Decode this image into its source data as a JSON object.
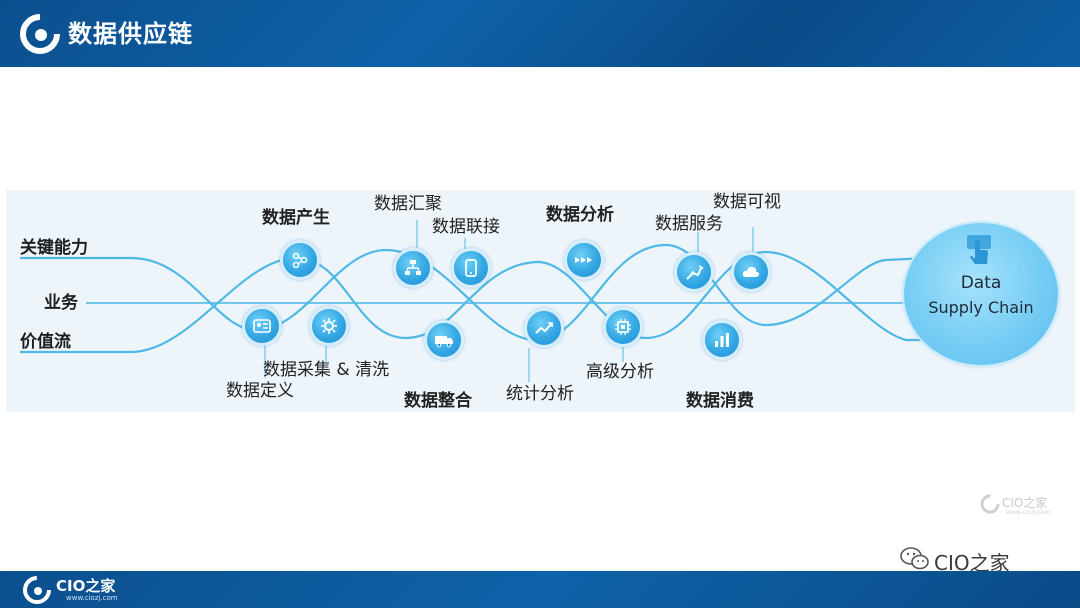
{
  "header": {
    "title": "数据供应链"
  },
  "rows": {
    "capability": "关键能力",
    "business": "业务",
    "value_stream": "价值流"
  },
  "stages": {
    "generate": "数据产生",
    "define": "数据定义",
    "collect_clean": "数据采集 & 清洗",
    "aggregate": "数据汇聚",
    "connect": "数据联接",
    "integrate": "数据整合",
    "analyze": "数据分析",
    "statistics": "统计分析",
    "advanced": "高级分析",
    "service": "数据服务",
    "visualize": "数据可视",
    "consume": "数据消费"
  },
  "hub": {
    "line1": "Data",
    "line2": "Supply Chain"
  },
  "watermark": {
    "brand": "CIO之家",
    "site": "www.ciozj.com"
  },
  "wechat": {
    "label": "CIO之家"
  },
  "footer": {
    "brand": "CIO之家",
    "site": "www.ciozj.com"
  },
  "colors": {
    "header": "#0b4f8e",
    "wave": "#4fb9e6",
    "node": "#33a6e3",
    "hub": "#76cdf4",
    "panel": "#edf5fb"
  },
  "icons": {
    "generate": "network-icon",
    "define": "id-card-icon",
    "collect_clean": "gear-icon",
    "aggregate": "hierarchy-icon",
    "connect": "phone-icon",
    "integrate": "truck-icon",
    "analyze": "arrows-icon",
    "statistics": "trend-icon",
    "advanced": "chip-icon",
    "service": "robot-arm-icon",
    "visualize": "cloud-icon",
    "consume": "bar-chart-icon",
    "hub": "hand-pointer-icon"
  }
}
